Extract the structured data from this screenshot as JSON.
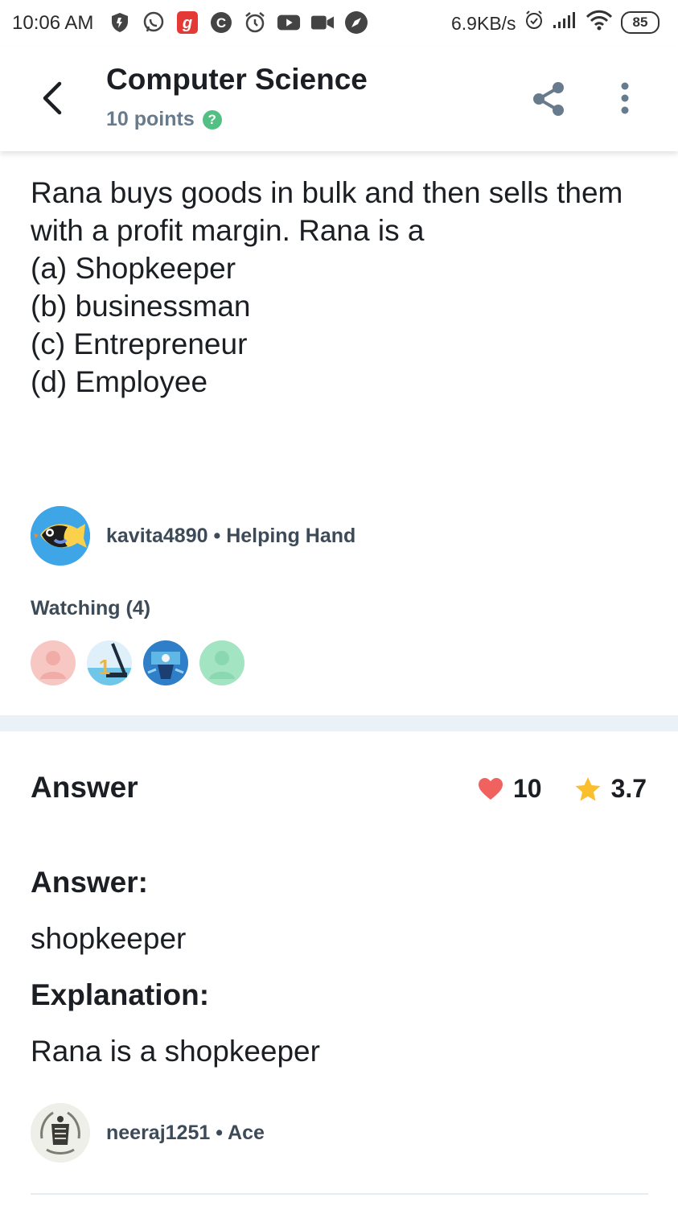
{
  "status_bar": {
    "time": "10:06 AM",
    "network_speed": "6.9KB/s",
    "battery": "85",
    "icons": [
      "shield-icon",
      "whatsapp-icon",
      "gaana-icon",
      "c-app-icon",
      "alarm-icon",
      "youtube-icon",
      "video-icon",
      "compass-icon"
    ]
  },
  "header": {
    "title": "Computer Science",
    "points": "10 points",
    "help_symbol": "?"
  },
  "question": {
    "lines": [
      "Rana buys goods in bulk and then sells them with a profit margin. Rana is a",
      "(a) Shopkeeper",
      "(b) businessman",
      "(c) Entrepreneur",
      "(d) Employee"
    ]
  },
  "asker": {
    "username": "kavita4890",
    "rank": "Helping Hand",
    "separator": "•"
  },
  "watching": {
    "label": "Watching (4)",
    "count": 4
  },
  "answer": {
    "heading": "Answer",
    "thanks": "10",
    "rating": "3.7",
    "answer_label": "Answer:",
    "answer_text": "shopkeeper",
    "explanation_label": "Explanation:",
    "explanation_text": "Rana is a shopkeeper"
  },
  "answerer": {
    "username": "neeraj1251",
    "rank": "Ace",
    "separator": "•"
  },
  "colors": {
    "accent_green": "#53bf84",
    "heart": "#f0625f",
    "star": "#fbbe2e",
    "divider": "#ebf2f7"
  }
}
